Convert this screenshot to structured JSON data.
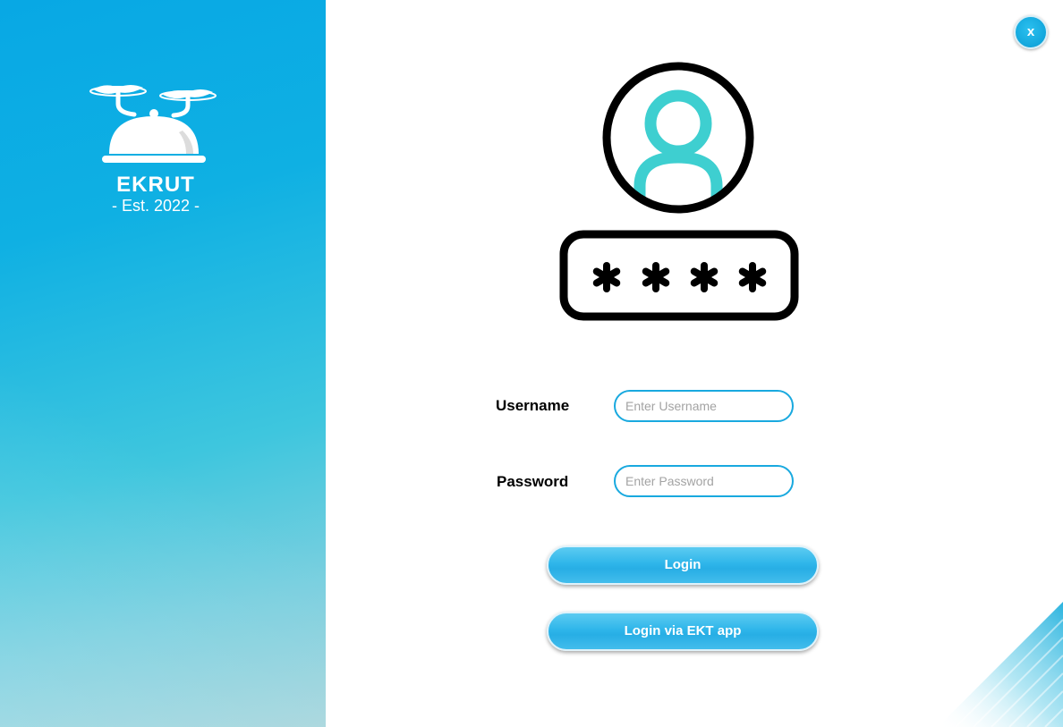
{
  "brand": {
    "name": "Ekrut",
    "subtitle": "- Est. 2022 -"
  },
  "window": {
    "close_label": "x"
  },
  "form": {
    "username_label": "Username",
    "username_placeholder": "Enter Username",
    "username_value": "",
    "password_label": "Password",
    "password_placeholder": "Enter Password",
    "password_value": ""
  },
  "actions": {
    "login_label": "Login",
    "login_app_label": "Login via EKT app"
  },
  "colors": {
    "accent": "#19a9df",
    "sidebar_top": "#08a8e4",
    "sidebar_bottom": "#a5d5dc",
    "avatar_teal": "#3ecfd0"
  },
  "icons": {
    "logo": "drone-cloche-icon",
    "hero": "user-password-icon",
    "close": "close-icon"
  }
}
